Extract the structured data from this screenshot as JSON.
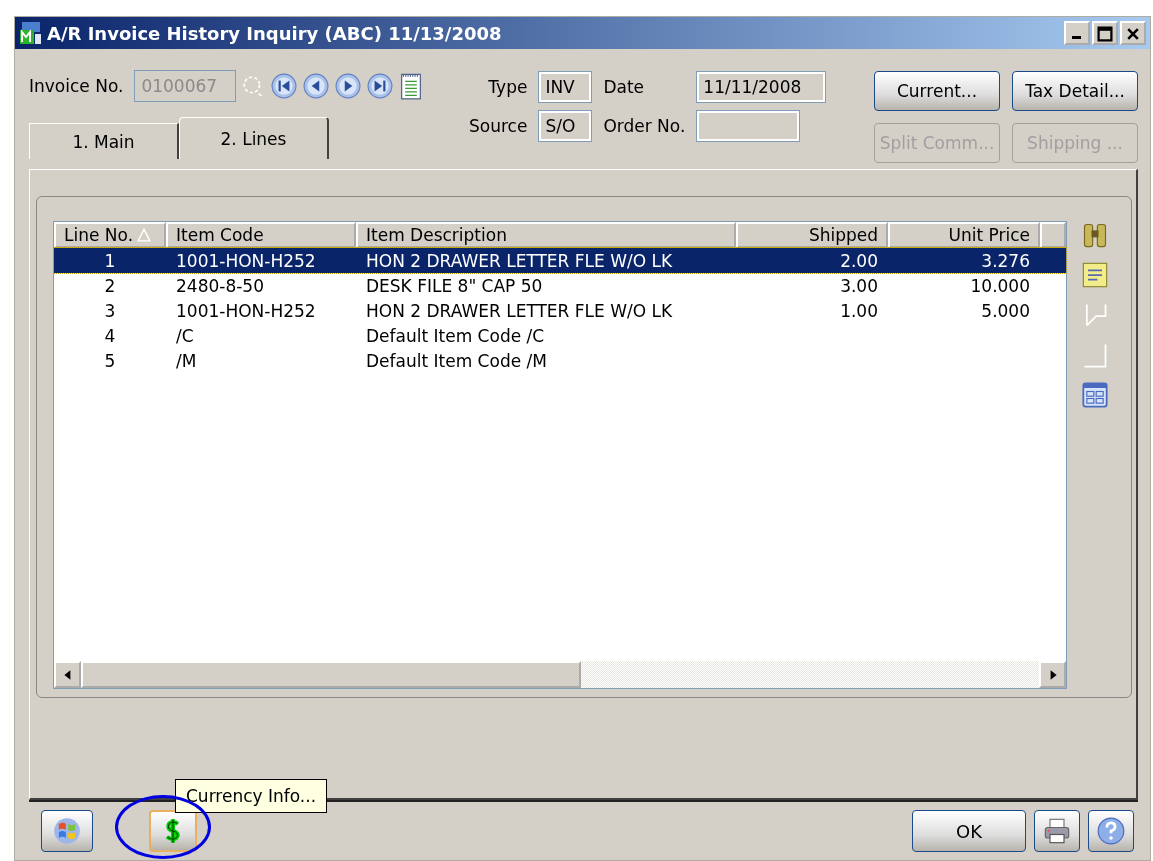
{
  "window": {
    "title": "A/R Invoice History Inquiry (ABC) 11/13/2008"
  },
  "header": {
    "invoice_label": "Invoice No.",
    "invoice_value": "0100067",
    "type_label": "Type",
    "type_value": "INV",
    "source_label": "Source",
    "source_value": "S/O",
    "date_label": "Date",
    "date_value": "11/11/2008",
    "order_label": "Order No."
  },
  "buttons": [
    {
      "label": "Current...",
      "disabled": false
    },
    {
      "label": "Tax Detail...",
      "disabled": false
    },
    {
      "label": "Split Comm...",
      "disabled": true
    },
    {
      "label": "Shipping ...",
      "disabled": true
    }
  ],
  "tabs": [
    {
      "label": "1. Main",
      "selected": false
    },
    {
      "label": "2. Lines",
      "selected": true
    }
  ],
  "table": {
    "columns": [
      {
        "label": "Line No."
      },
      {
        "label": "Item Code"
      },
      {
        "label": "Item Description"
      },
      {
        "label": "Shipped"
      },
      {
        "label": "Unit Price"
      }
    ],
    "rows": [
      {
        "selected": true,
        "cells": [
          "1",
          "1001-HON-H252",
          "HON 2 DRAWER LETTER FLE W/O LK",
          "2.00",
          "3.276"
        ]
      },
      {
        "selected": false,
        "cells": [
          "2",
          "2480-8-50",
          "DESK FILE 8\" CAP 50",
          "3.00",
          "10.000"
        ]
      },
      {
        "selected": false,
        "cells": [
          "3",
          "1001-HON-H252",
          "HON 2 DRAWER LETTER FLE W/O LK",
          "1.00",
          "5.000"
        ]
      },
      {
        "selected": false,
        "cells": [
          "4",
          "/C",
          "Default Item Code /C",
          "",
          ""
        ]
      },
      {
        "selected": false,
        "cells": [
          "5",
          "/M",
          "Default Item Code /M",
          "",
          ""
        ]
      }
    ]
  },
  "tooltip": "Currency Info...",
  "ok_button": "OK"
}
